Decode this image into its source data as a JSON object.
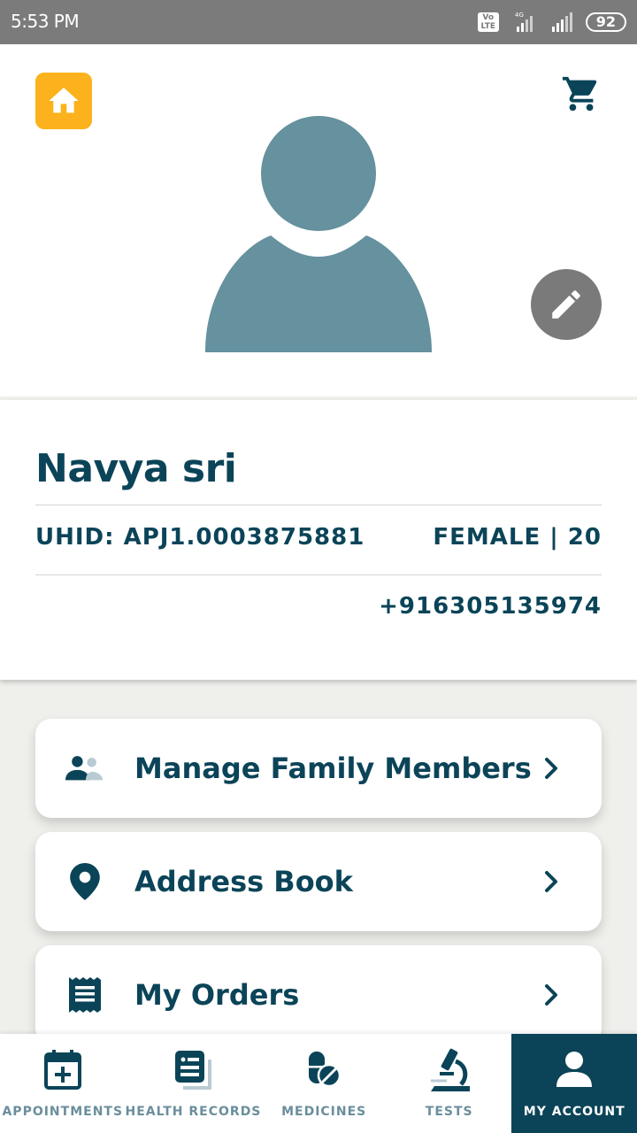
{
  "status_bar": {
    "time": "5:53 PM",
    "volte": "Vo LTE",
    "network": "4G",
    "battery": "92"
  },
  "header": {
    "home_icon": "home-icon",
    "cart_icon": "cart-icon",
    "edit_icon": "pencil-icon",
    "accent": "#fbb21c"
  },
  "profile": {
    "name": "Navya sri",
    "uhid": "UHID: APJ1.0003875881",
    "gender_age": "FEMALE | 20",
    "phone": "+916305135974"
  },
  "menu": [
    {
      "label": "Manage Family Members",
      "icon": "family-icon"
    },
    {
      "label": "Address Book",
      "icon": "location-pin-icon"
    },
    {
      "label": "My Orders",
      "icon": "receipt-icon"
    }
  ],
  "nav": [
    {
      "label": "APPOINTMENTS",
      "icon": "calendar-plus-icon"
    },
    {
      "label": "HEALTH RECORDS",
      "icon": "records-icon"
    },
    {
      "label": "MEDICINES",
      "icon": "pills-icon"
    },
    {
      "label": "TESTS",
      "icon": "microscope-icon"
    },
    {
      "label": "MY ACCOUNT",
      "icon": "user-icon",
      "active": true
    }
  ],
  "colors": {
    "primary": "#0b4458",
    "avatar": "#66919e",
    "nav_inactive": "#6a8e9c"
  }
}
